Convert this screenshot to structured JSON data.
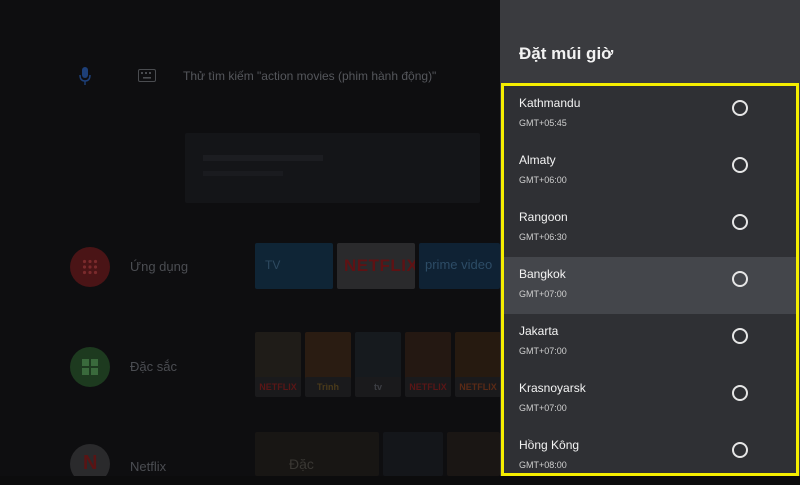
{
  "home": {
    "search_hint": "Thử tìm kiếm \"action movies (phim hành động)\"",
    "rows": [
      {
        "label": "Ứng dụng"
      },
      {
        "label": "Đặc sắc"
      },
      {
        "label": "Netflix"
      }
    ],
    "app_tiles": [
      {
        "label": "TV"
      },
      {
        "label": "NETFLIX"
      },
      {
        "label": "prime video"
      }
    ],
    "featured_logos": [
      "NETFLIX",
      "Trình",
      "tv",
      "NETFLIX",
      "NETFLIX"
    ],
    "bottom_tile_text": "Đặc"
  },
  "panel": {
    "title": "Đặt múi giờ",
    "timezones": [
      {
        "name": "Kathmandu",
        "offset": "GMT+05:45"
      },
      {
        "name": "Almaty",
        "offset": "GMT+06:00"
      },
      {
        "name": "Rangoon",
        "offset": "GMT+06:30"
      },
      {
        "name": "Bangkok",
        "offset": "GMT+07:00"
      },
      {
        "name": "Jakarta",
        "offset": "GMT+07:00"
      },
      {
        "name": "Krasnoyarsk",
        "offset": "GMT+07:00"
      },
      {
        "name": "Hồng Kông",
        "offset": "GMT+08:00"
      }
    ],
    "focused_index": 3
  },
  "colors": {
    "highlight_border": "#f5ee00",
    "panel_bg": "#3a3b3f",
    "focused_row": "#44464b"
  }
}
